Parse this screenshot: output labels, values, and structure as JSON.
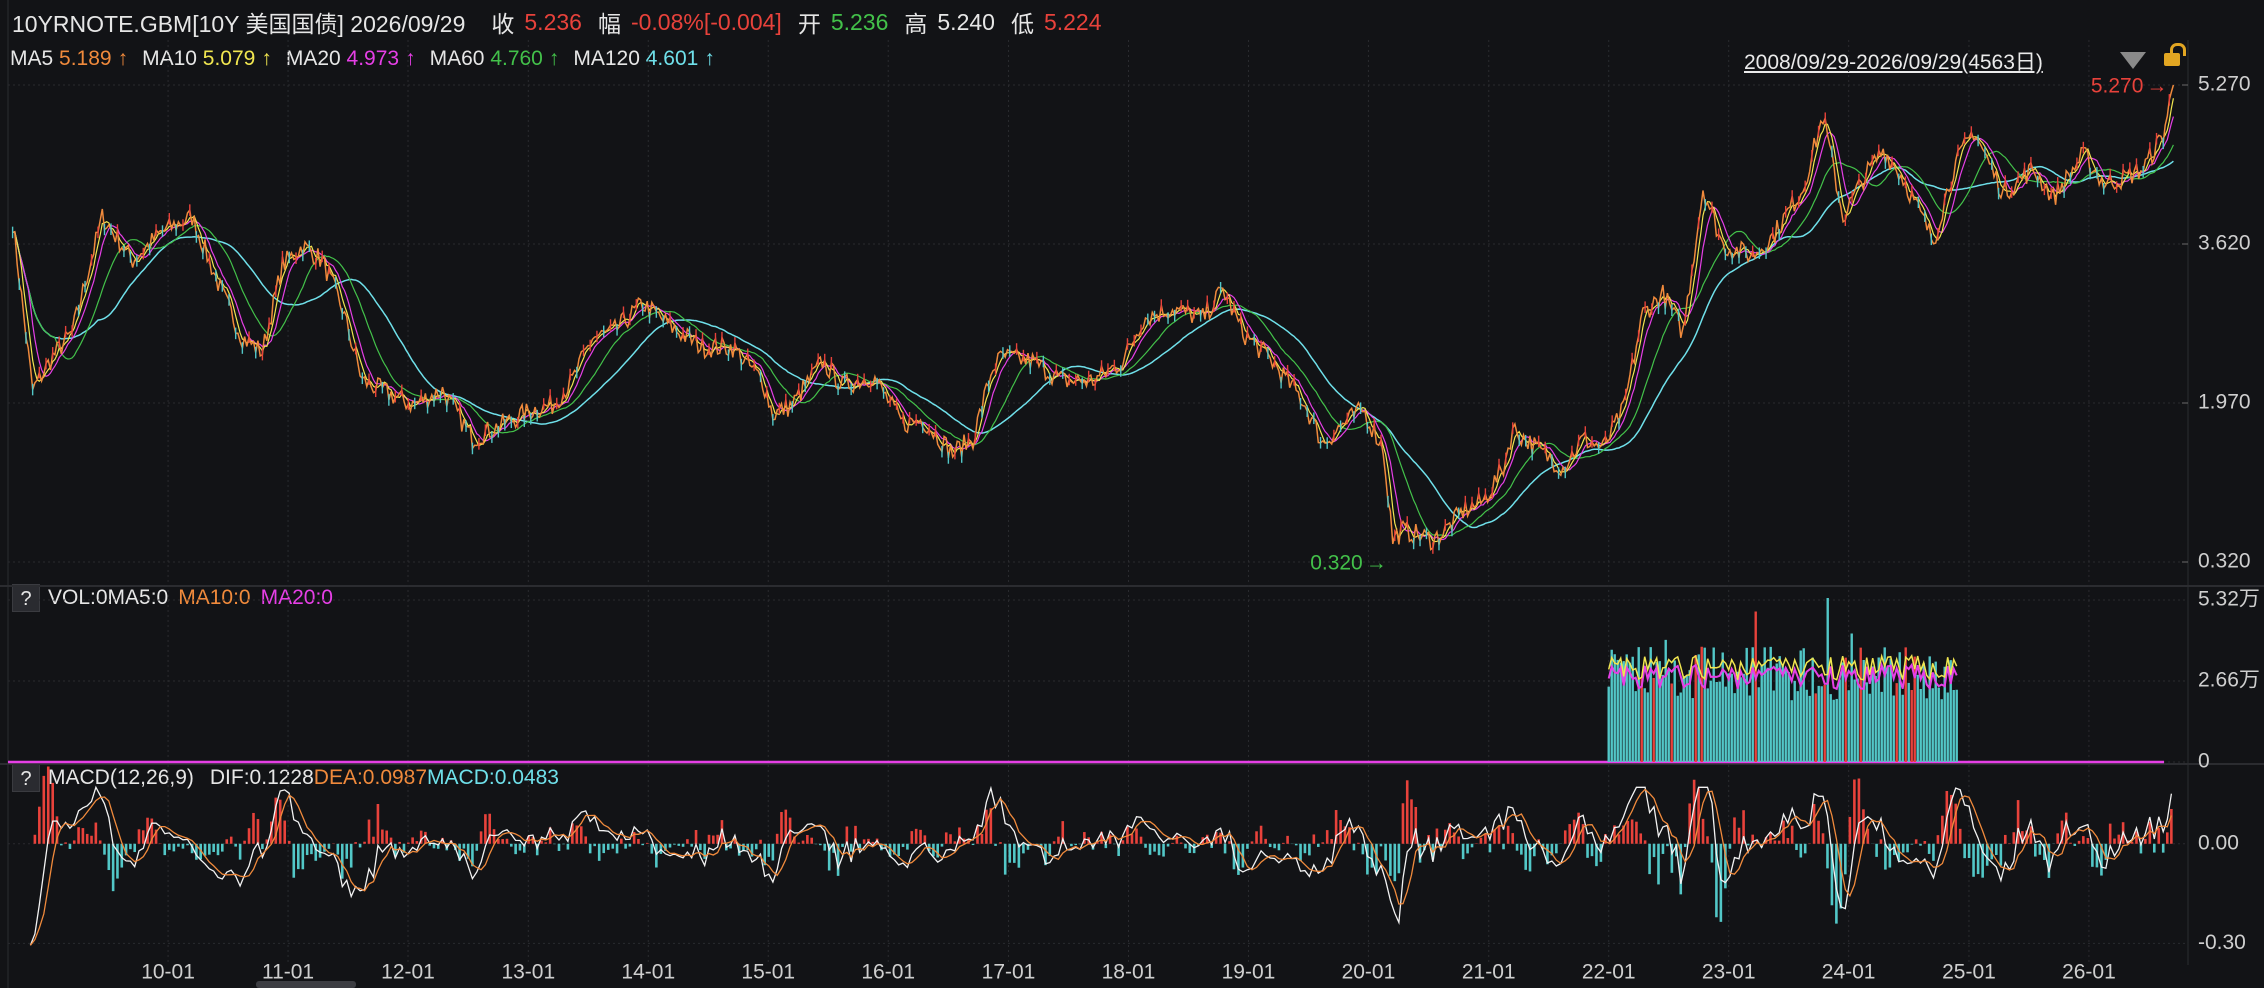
{
  "header": {
    "symbol": "10YRNOTE.GBM[10Y 美国国债] 2026/09/29",
    "close_label": "收",
    "close_value": "5.236",
    "change_label": "幅",
    "change_value": "-0.08%[-0.004]",
    "open_label": "开",
    "open_value": "5.236",
    "high_label": "高",
    "high_value": "5.240",
    "low_label": "低",
    "low_value": "5.224"
  },
  "ma_legend": [
    {
      "label": "MA5",
      "value": "5.189",
      "arrow": "↑",
      "color": "#f08a3c"
    },
    {
      "label": "MA10",
      "value": "5.079",
      "arrow": "↑",
      "color": "#f1e650"
    },
    {
      "label": "MA20",
      "value": "4.973",
      "arrow": "↑",
      "color": "#e63fe6"
    },
    {
      "label": "MA60",
      "value": "4.760",
      "arrow": "↑",
      "color": "#43c14a"
    },
    {
      "label": "MA120",
      "value": "4.601",
      "arrow": "↑",
      "color": "#6fe0ea"
    }
  ],
  "date_range": "2008/09/29-2026/09/29(4563日)",
  "vol_panel": {
    "help": "?",
    "label": "VOL:0MA5:0",
    "ma10": "MA10:0",
    "ma20": "MA20:0"
  },
  "macd_panel": {
    "help": "?",
    "label": "MACD(12,26,9)",
    "dif": "DIF:0.1228",
    "dea": "DEA:0.0987",
    "macd": "MACD:0.0483"
  },
  "colors": {
    "up": "#e8423b",
    "down": "#52c7c7",
    "green": "#43c14a",
    "orange": "#f08a3c",
    "magenta": "#e63fe6",
    "cyan": "#6fe0ea",
    "yellow": "#f1e650"
  },
  "chart_data": [
    {
      "type": "line",
      "name": "price",
      "y_axis_ticks": [
        "5.270",
        "3.620",
        "1.970",
        "0.320"
      ],
      "ylim": [
        0.32,
        5.27
      ],
      "x_ticks": [
        "10-01",
        "11-01",
        "12-01",
        "13-01",
        "14-01",
        "15-01",
        "16-01",
        "17-01",
        "18-01",
        "19-01",
        "20-01",
        "21-01",
        "22-01",
        "23-01",
        "24-01",
        "25-01",
        "26-01"
      ],
      "annotations": [
        {
          "text": "5.270",
          "color": "#e8423b"
        },
        {
          "text": "0.320",
          "color": "#43c14a"
        }
      ],
      "x": [
        "2008-09",
        "2008-11",
        "2009-01",
        "2009-03",
        "2009-06",
        "2009-09",
        "2009-12",
        "2010-03",
        "2010-06",
        "2010-08",
        "2010-10",
        "2010-12",
        "2011-02",
        "2011-04",
        "2011-06",
        "2011-08",
        "2011-10",
        "2012-01",
        "2012-04",
        "2012-07",
        "2012-10",
        "2013-01",
        "2013-03",
        "2013-05",
        "2013-07",
        "2013-09",
        "2013-12",
        "2014-03",
        "2014-06",
        "2014-09",
        "2014-12",
        "2015-01",
        "2015-03",
        "2015-06",
        "2015-08",
        "2015-11",
        "2016-02",
        "2016-04",
        "2016-07",
        "2016-09",
        "2016-11",
        "2016-12",
        "2017-03",
        "2017-06",
        "2017-09",
        "2017-12",
        "2018-02",
        "2018-05",
        "2018-08",
        "2018-10",
        "2018-12",
        "2019-03",
        "2019-06",
        "2019-08",
        "2019-10",
        "2019-12",
        "2020-02",
        "2020-03",
        "2020-04",
        "2020-07",
        "2020-08",
        "2020-10",
        "2020-12",
        "2021-02",
        "2021-03",
        "2021-06",
        "2021-08",
        "2021-10",
        "2021-12",
        "2022-02",
        "2022-04",
        "2022-06",
        "2022-08",
        "2022-10",
        "2022-12",
        "2023-03",
        "2023-05",
        "2023-08",
        "2023-10",
        "2023-12",
        "2024-02",
        "2024-04",
        "2024-06",
        "2024-09",
        "2024-11",
        "2025-01",
        "2025-04",
        "2025-07",
        "2025-09",
        "2025-12",
        "2026-02",
        "2026-04",
        "2026-06",
        "2026-08",
        "2026-09"
      ],
      "series": [
        {
          "values": [
            3.85,
            2.1,
            2.45,
            2.7,
            3.9,
            3.45,
            3.75,
            3.9,
            3.1,
            2.65,
            2.5,
            3.4,
            3.6,
            3.45,
            2.95,
            2.2,
            2.1,
            1.95,
            2.1,
            1.6,
            1.75,
            1.9,
            1.95,
            2.2,
            2.65,
            2.7,
            3.0,
            2.75,
            2.55,
            2.55,
            2.2,
            1.85,
            1.95,
            2.4,
            2.15,
            2.25,
            1.75,
            1.8,
            1.45,
            1.6,
            2.35,
            2.45,
            2.4,
            2.2,
            2.2,
            2.4,
            2.85,
            2.95,
            2.85,
            3.15,
            2.7,
            2.4,
            2.0,
            1.55,
            1.75,
            1.9,
            1.5,
            0.55,
            0.65,
            0.55,
            0.62,
            0.85,
            0.95,
            1.3,
            1.7,
            1.45,
            1.3,
            1.6,
            1.5,
            1.9,
            2.9,
            3.1,
            2.7,
            4.2,
            3.6,
            3.5,
            3.7,
            4.2,
            4.95,
            3.9,
            4.3,
            4.6,
            4.3,
            3.65,
            4.4,
            4.8,
            4.15,
            4.4,
            4.1,
            4.55,
            4.25,
            4.3,
            4.4,
            4.75,
            5.27
          ]
        }
      ]
    },
    {
      "type": "bar",
      "name": "volume",
      "y_axis_ticks": [
        "5.32万",
        "2.66万",
        "0"
      ],
      "ylim": [
        0,
        5.32
      ],
      "range": [
        "2022-01",
        "2024-12"
      ]
    },
    {
      "type": "bar",
      "name": "macd",
      "y_axis_ticks": [
        "0.00",
        "-0.30"
      ],
      "ylim": [
        -0.35,
        0.18
      ]
    }
  ]
}
